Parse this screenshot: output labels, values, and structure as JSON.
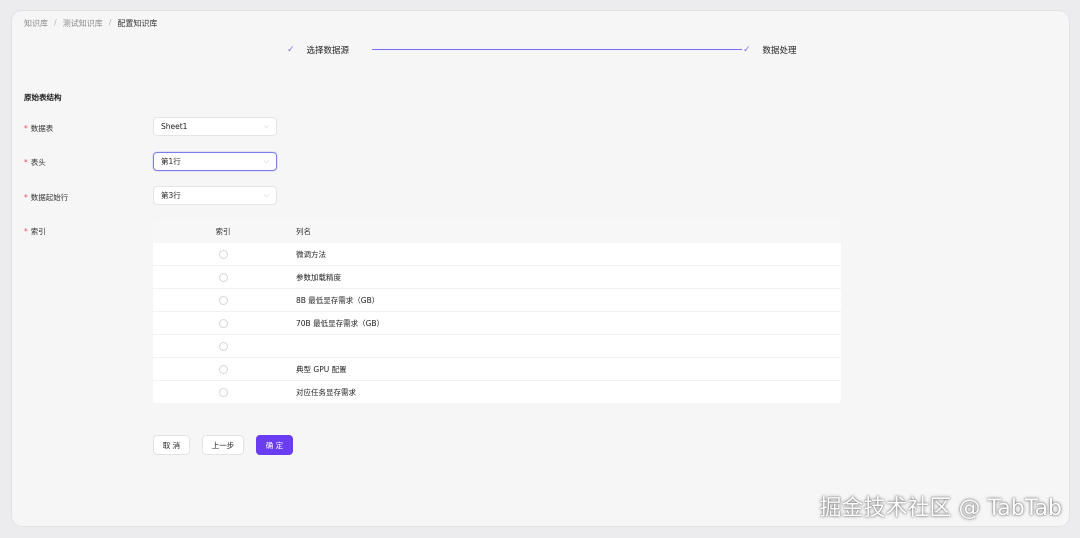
{
  "breadcrumb": {
    "items": [
      "知识库",
      "测试知识库",
      "配置知识库"
    ],
    "separator": "/"
  },
  "steps": [
    {
      "label": "选择数据源",
      "icon": "check-icon",
      "status": "done"
    },
    {
      "label": "数据处理",
      "icon": "check-icon",
      "status": "active"
    }
  ],
  "section_title": "原始表结构",
  "form": {
    "required_mark": "*",
    "sheet": {
      "label": "数据表",
      "value": "Sheet1"
    },
    "header_row": {
      "label": "表头",
      "value": "第1行"
    },
    "data_start_row": {
      "label": "数据起始行",
      "value": "第3行"
    },
    "index": {
      "label": "索引"
    }
  },
  "table": {
    "columns": [
      "索引",
      "列名"
    ],
    "rows": [
      {
        "name": "微调方法",
        "selected": false
      },
      {
        "name": "参数加载精度",
        "selected": false
      },
      {
        "name": "8B 最低显存需求（GB）",
        "selected": false
      },
      {
        "name": "70B 最低显存需求（GB）",
        "selected": false
      },
      {
        "name": "",
        "selected": false
      },
      {
        "name": "典型 GPU 配置",
        "selected": false
      },
      {
        "name": "对应任务显存需求",
        "selected": false
      }
    ]
  },
  "buttons": {
    "cancel": "取 消",
    "prev": "上一步",
    "confirm": "确 定"
  },
  "colors": {
    "accent": "#6a3df2",
    "step_line": "#7b6ef6",
    "required": "#e05555"
  },
  "watermark": "掘金技术社区 @ TabTab"
}
